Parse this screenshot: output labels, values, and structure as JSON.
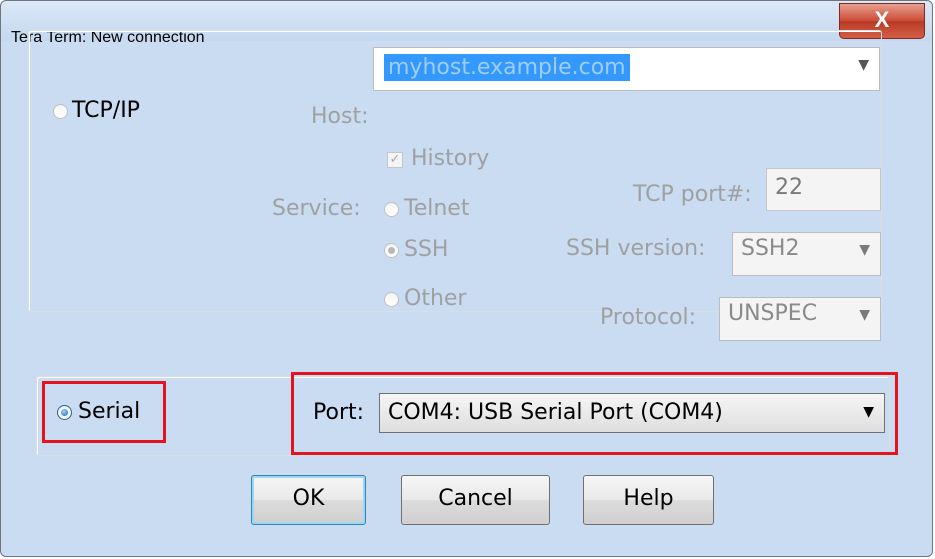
{
  "window": {
    "title": "Tera Term: New connection",
    "close_glyph": "X"
  },
  "tcp": {
    "radio_label": "TCP/IP",
    "host_label": "Host:",
    "host_value": "myhost.example.com",
    "history_label": "History",
    "service_label": "Service:",
    "telnet_label": "Telnet",
    "ssh_label": "SSH",
    "other_label": "Other",
    "tcp_port_label": "TCP port#:",
    "tcp_port_value": "22",
    "ssh_version_label": "SSH version:",
    "ssh_version_value": "SSH2",
    "protocol_label": "Protocol:",
    "protocol_value": "UNSPEC"
  },
  "serial": {
    "radio_label": "Serial",
    "port_label": "Port:",
    "port_value": "COM4: USB Serial Port (COM4)"
  },
  "buttons": {
    "ok": "OK",
    "cancel": "Cancel",
    "help": "Help"
  },
  "colors": {
    "highlight_red": "#e4141e",
    "selection_blue": "#3399ff"
  }
}
